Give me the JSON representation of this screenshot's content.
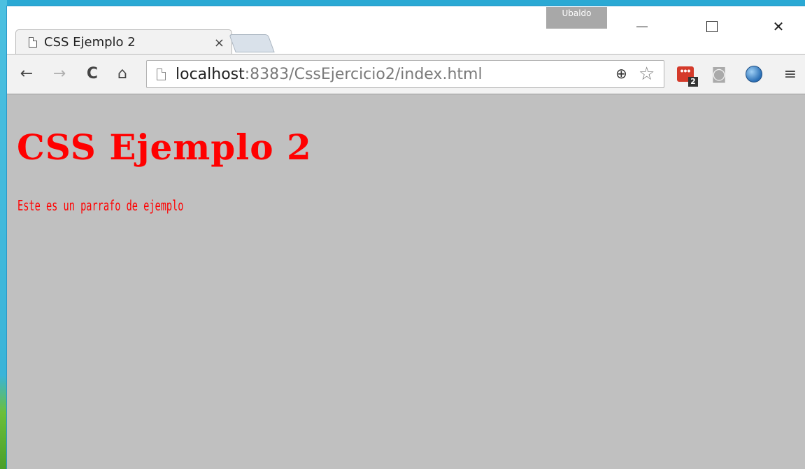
{
  "window": {
    "profile_name": "Ubaldo"
  },
  "tab": {
    "title": "CSS Ejemplo 2",
    "close_glyph": "×"
  },
  "toolbar": {
    "back_glyph": "←",
    "forward_glyph": "→",
    "reload_glyph": "C",
    "home_glyph": "⌂",
    "url_host": "localhost",
    "url_rest": ":8383/CssEjercicio2/index.html",
    "zoom_glyph": "⊕",
    "star_glyph": "☆",
    "ext_badge_count": "2",
    "ext_red_glyph": "•••",
    "camera_glyph": "◙",
    "menu_glyph": "≡"
  },
  "page": {
    "heading": "CSS Ejemplo 2",
    "paragraph": "Este es un parrafo de ejemplo",
    "background_color": "#c0c0c0",
    "text_color": "#ff0000"
  }
}
